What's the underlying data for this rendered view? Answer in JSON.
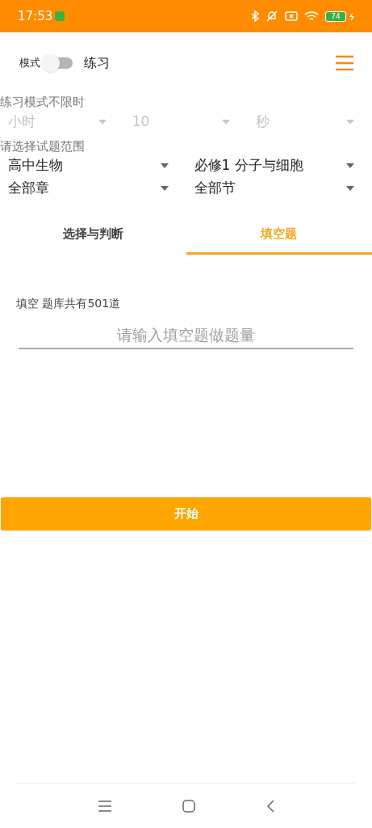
{
  "status_bar": {
    "time": "17:53",
    "battery": "74"
  },
  "header": {
    "mode_label": "模式",
    "mode_switch": {
      "on": false
    },
    "mode_value": "练习"
  },
  "timer": {
    "label": "练习模式不限时",
    "disabled": true,
    "selects": [
      {
        "value": "小时"
      },
      {
        "value": "10"
      },
      {
        "value": "秒"
      }
    ]
  },
  "range": {
    "label": "请选择试题范围",
    "selects": [
      {
        "value": "高中生物"
      },
      {
        "value": "必修1 分子与细胞"
      },
      {
        "value": "全部章"
      },
      {
        "value": "全部节"
      }
    ]
  },
  "tabs": [
    {
      "label": "选择与判断",
      "selected": false
    },
    {
      "label": "填空题",
      "selected": true
    }
  ],
  "info": "填空 题库共有501道",
  "count_field": {
    "placeholder": "请输入填空题做题量"
  },
  "start_button": "开始"
}
